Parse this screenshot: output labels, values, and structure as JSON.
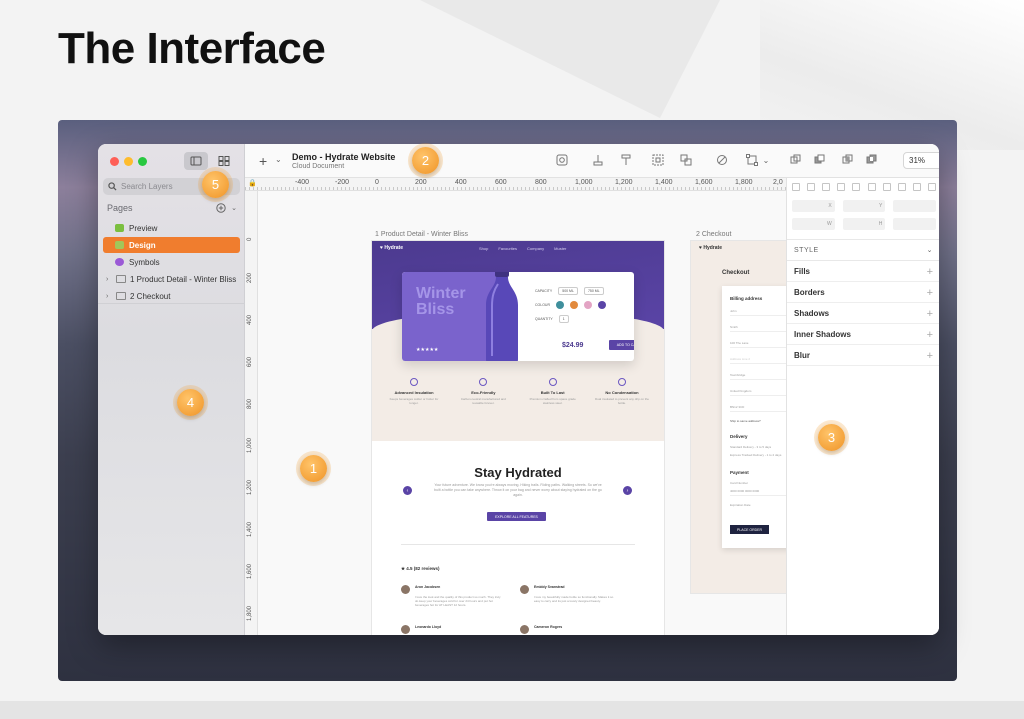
{
  "slide": {
    "title": "The Interface"
  },
  "sidebar": {
    "search_placeholder": "Search Layers",
    "pages_label": "Pages",
    "pages": [
      {
        "label": "Preview",
        "swatch": "#7bbf3f"
      },
      {
        "label": "Design",
        "swatch": "#a2c65a",
        "active": true
      },
      {
        "label": "Symbols",
        "swatch": "#9b59d6"
      }
    ],
    "artboards": [
      {
        "label": "1 Product Detail - Winter Bliss"
      },
      {
        "label": "2 Checkout"
      }
    ]
  },
  "toolbar": {
    "insert_icon": "plus-icon",
    "doc_title": "Demo - Hydrate Website",
    "doc_subtitle": "Cloud Document",
    "zoom_value": "31%"
  },
  "ruler": {
    "top_ticks": [
      "-400",
      "-200",
      "0",
      "200",
      "400",
      "600",
      "800",
      "1,000",
      "1,200",
      "1,400",
      "1,600",
      "1,800",
      "2,0"
    ],
    "left_ticks": [
      "0",
      "200",
      "400",
      "600",
      "800",
      "1,000",
      "1,200",
      "1,400",
      "1,600",
      "1,800"
    ]
  },
  "canvas": {
    "artboard1_label": "1 Product Detail - Winter Bliss",
    "artboard2_label": "2 Checkout",
    "brand": "Hydrate",
    "nav_links": [
      "Shop",
      "Favourites",
      "Company",
      "Muster"
    ],
    "product_title": "Winter Bliss",
    "capacity_label": "CAPACITY",
    "capacity_options": [
      "500 ML",
      "750 ML"
    ],
    "colour_label": "COLOUR",
    "quantity_label": "QUANTITY",
    "quantity_value": "1",
    "price": "$24.99",
    "add_to_cart": "ADD TO CART",
    "features": [
      {
        "title": "Advanced Insulation",
        "text": "Keeps beverages colder or hotter for longer."
      },
      {
        "title": "Eco-Friendly",
        "text": "Carbon-neutral manufactured and reusable forever."
      },
      {
        "title": "Built To Last",
        "text": "Premium crafted from space grade stainless steel."
      },
      {
        "title": "No Condensation",
        "text": "Dual insulated to prevent any drip on the bottle."
      }
    ],
    "section_title": "Stay Hydrated",
    "section_text": "Your future adventure. We know you're always moving. Hiking trails. Riding paths. Walking streets. So we've built a bottle you can take anywhere. Throw it on your bag and never worry about staying hydrated on the go again.",
    "explore_button": "EXPLORE ALL FEATURES",
    "rating_text": "★ 4.5 (82 reviews)",
    "reviews": [
      {
        "name": "Aron Jacobsen",
        "text": "I love the look and the quality of this product so much. They truly do keep your beverages cold for over 24 hours and put hot beverages hot for AT LEAST 12 hours."
      },
      {
        "name": "Emiddy Svanstrad",
        "text": "I love my beautifully made bottle so functionally. Makes it so easy to carry and its just a lovely designed beauty."
      },
      {
        "name": "Leonardo Lloyd",
        "text": ""
      },
      {
        "name": "Cameron Rogers",
        "text": ""
      }
    ],
    "checkout_title": "Checkout",
    "billing_label": "Billing address",
    "billing_fields": [
      "John",
      "Smith",
      "100 The Lane",
      "Address Line 2",
      "Townbridge",
      "United Kingdom",
      "BN12 3CD"
    ],
    "ship_note": "Ship to same address?",
    "delivery_label": "Delivery",
    "delivery_options": [
      "Standard Delivery - 3 to 5 days",
      "Express Tracked Delivery - 1 to 2 days"
    ],
    "payment_label": "Payment",
    "card_label": "Card Number",
    "card_value": "4000 0000 0000 0000",
    "expiry_label": "Expiration Date",
    "place_order": "PLACE ORDER"
  },
  "inspector": {
    "style_label": "STYLE",
    "sections": [
      "Fills",
      "Borders",
      "Shadows",
      "Inner Shadows",
      "Blur"
    ],
    "dims_row1": [
      "X",
      "Y",
      ""
    ],
    "dims_row2": [
      "W",
      "H",
      ""
    ]
  },
  "callouts": [
    "1",
    "2",
    "3",
    "4",
    "5"
  ],
  "colors": {
    "accent": "#f07d2e",
    "brand_purple": "#5a44a6",
    "callout": "#f4a23a"
  }
}
